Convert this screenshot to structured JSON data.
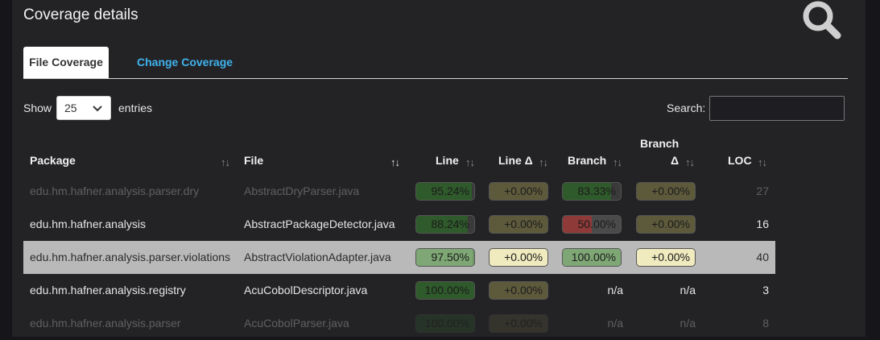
{
  "page": {
    "title": "Coverage details"
  },
  "tabs": [
    {
      "label": "File Coverage",
      "active": true
    },
    {
      "label": "Change Coverage",
      "active": false
    }
  ],
  "length": {
    "show": "Show",
    "value": "25",
    "entries": "entries"
  },
  "search": {
    "label": "Search:",
    "value": ""
  },
  "columns": {
    "package": "Package",
    "file": "File",
    "line": "Line",
    "line_delta": "Line Δ",
    "branch": "Branch",
    "branch_delta_1": "Branch",
    "branch_delta_2": "Δ",
    "loc": "LOC"
  },
  "sort_glyph": "↑↓",
  "rows": [
    {
      "package": "edu.hm.hafner.analysis.parser.dry",
      "file": "AbstractDryParser.java",
      "line": "95.24%",
      "line_pct": 95.24,
      "line_delta": "+0.00%",
      "branch": "83.33%",
      "branch_pct": 83.33,
      "branch_delta": "+0.00%",
      "loc": "27"
    },
    {
      "package": "edu.hm.hafner.analysis",
      "file": "AbstractPackageDetector.java",
      "line": "88.24%",
      "line_pct": 88.24,
      "line_delta": "+0.00%",
      "branch": "50.00%",
      "branch_pct": 50.0,
      "branch_delta": "+0.00%",
      "loc": "16"
    },
    {
      "package": "edu.hm.hafner.analysis.parser.violations",
      "file": "AbstractViolationAdapter.java",
      "line": "97.50%",
      "line_pct": 97.5,
      "line_delta": "+0.00%",
      "branch": "100.00%",
      "branch_pct": 100.0,
      "branch_delta": "+0.00%",
      "loc": "40"
    },
    {
      "package": "edu.hm.hafner.analysis.registry",
      "file": "AcuCobolDescriptor.java",
      "line": "100.00%",
      "line_pct": 100.0,
      "line_delta": "+0.00%",
      "branch": "n/a",
      "branch_pct": null,
      "branch_delta": "n/a",
      "loc": "3"
    },
    {
      "package": "edu.hm.hafner.analysis.parser",
      "file": "AcuCobolParser.java",
      "line": "100.00%",
      "line_pct": 100.0,
      "line_delta": "+0.00%",
      "branch": "n/a",
      "branch_pct": null,
      "branch_delta": "n/a",
      "loc": "8"
    }
  ],
  "colors": {
    "line_fill_dark": "#2f5a2b",
    "line_fill_light": "#7fa775",
    "delta_dark": "#5d5a3c",
    "delta_light": "#f0eabf",
    "branch_low": "#8e3a38",
    "branch_low_light": "#6a4a4a",
    "branch_high": "#7fa775",
    "accent": "#3fb3ee"
  }
}
